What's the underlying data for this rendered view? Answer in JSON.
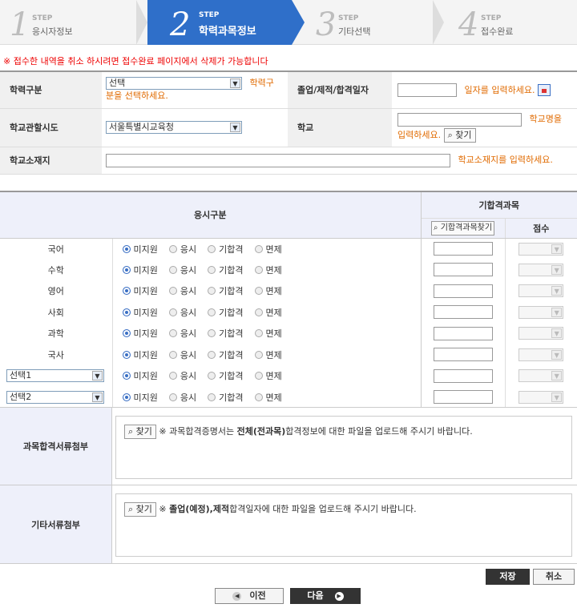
{
  "steps": [
    {
      "num": "1",
      "label": "STEP",
      "title": "응시자정보"
    },
    {
      "num": "2",
      "label": "STEP",
      "title": "학력과목정보"
    },
    {
      "num": "3",
      "label": "STEP",
      "title": "기타선택"
    },
    {
      "num": "4",
      "label": "STEP",
      "title": "접수완료"
    }
  ],
  "notice": "※ 접수한 내역을 취소 하시려면 접수완료 페이지에서 삭제가 가능합니다",
  "info": {
    "edu_type_label": "학력구분",
    "edu_type_value": "선택",
    "edu_type_hint_a": "학력구",
    "edu_type_hint_b": "분을 선택하세요.",
    "grad_date_label": "졸업/제적/합격일자",
    "grad_date_hint": "일자를 입력하세요.",
    "school_region_label": "학교관할시도",
    "school_region_value": "서울특별시교육청",
    "school_label": "학교",
    "school_hint_a": "학교명을",
    "school_hint_b": "입력하세요.",
    "find_btn": "찾기",
    "school_addr_label": "학교소재지",
    "school_addr_hint": "학교소재지를 입력하세요."
  },
  "subjects": {
    "header_exam": "응시구분",
    "header_pass": "기합격과목",
    "find_pass_btn": "기합격과목찾기",
    "header_score": "점수",
    "options": [
      "미지원",
      "응시",
      "기합격",
      "면제"
    ],
    "rows": [
      {
        "name": "국어"
      },
      {
        "name": "수학"
      },
      {
        "name": "영어"
      },
      {
        "name": "사회"
      },
      {
        "name": "과학"
      },
      {
        "name": "국사"
      },
      {
        "name": "선택1",
        "select": true
      },
      {
        "name": "선택2",
        "select": true
      }
    ]
  },
  "uploads": [
    {
      "label": "과목합격서류첨부",
      "btn": "찾기",
      "pre": "※ 과목합격증명서는 ",
      "bold": "전체(전과목)",
      "post": "합격정보에 대한 파일을 업로드해 주시기 바랍니다."
    },
    {
      "label": "기타서류첨부",
      "btn": "찾기",
      "pre": "※ ",
      "bold": "졸업(예정),제적",
      "post": "합격일자에 대한 파일을 업로드해 주시기 바랍니다."
    }
  ],
  "buttons": {
    "save": "저장",
    "cancel": "취소",
    "prev": "이전",
    "next": "다음"
  },
  "colors": {
    "accent": "#3a6fc4",
    "notice": "#e00000",
    "hint": "#e06a00"
  }
}
